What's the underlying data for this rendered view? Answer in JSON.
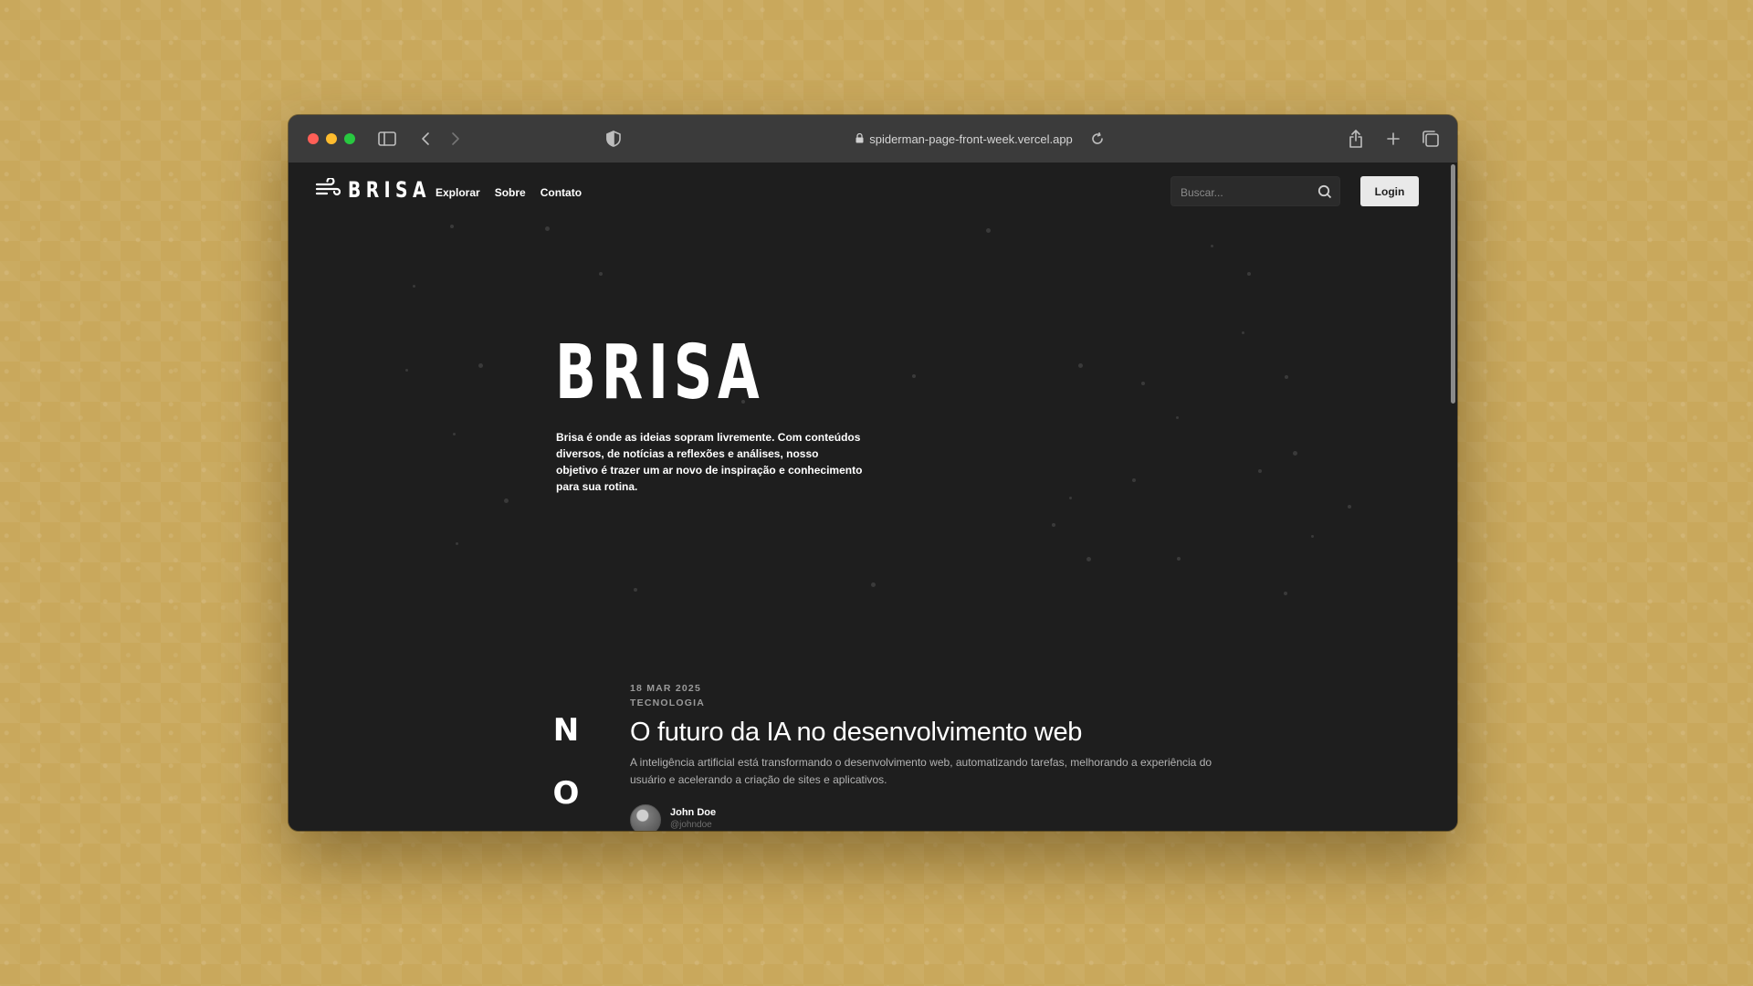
{
  "browser": {
    "url": "spiderman-page-front-week.vercel.app"
  },
  "nav": {
    "logo_text": "BRISA",
    "links": [
      "Explorar",
      "Sobre",
      "Contato"
    ],
    "search_placeholder": "Buscar...",
    "login_label": "Login"
  },
  "hero": {
    "title": "BRISA",
    "description": "Brisa é onde as ideias sopram livremente. Com conteúdos diversos, de notícias a reflexões e análises, nosso objetivo é trazer um ar novo de inspiração e conhecimento para sua rotina."
  },
  "section_vertical_letters": [
    "N",
    "O"
  ],
  "featured_article": {
    "date": "18 MAR 2025",
    "category": "TECNOLOGIA",
    "title": "O futuro da IA no desenvolvimento web",
    "excerpt": "A inteligência artificial está transformando o desenvolvimento web, automatizando tarefas, melhorando a experiência do usuário e acelerando a criação de sites e aplicativos.",
    "author_name": "John Doe",
    "author_handle": "@johndoe"
  }
}
